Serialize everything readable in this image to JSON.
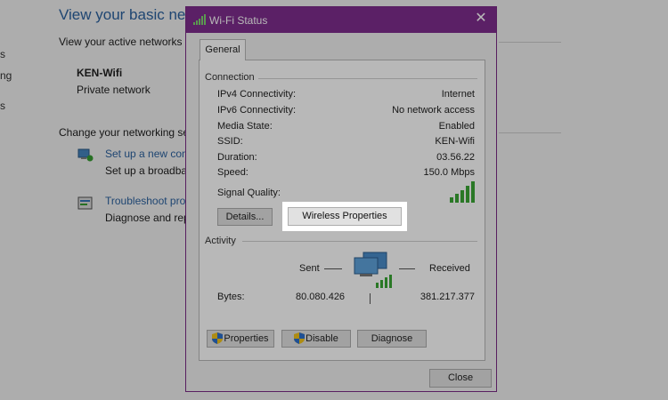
{
  "background": {
    "heading": "View your basic netw",
    "active_networks_label": "View your active networks",
    "network_name": "KEN-Wifi",
    "network_type": "Private network",
    "change_settings_label": "Change your networking se",
    "setup_link": "Set up a new conr",
    "setup_desc": "Set up a broadbar",
    "troubleshoot_link": "Troubleshoot prob",
    "troubleshoot_desc": "Diagnose and rep",
    "side_fragments": [
      "s",
      "ng",
      "s"
    ]
  },
  "dialog": {
    "title": "Wi-Fi Status",
    "close_glyph": "✕",
    "tab": "General",
    "connection": {
      "label": "Connection",
      "rows": [
        {
          "label": "IPv4 Connectivity:",
          "value": "Internet"
        },
        {
          "label": "IPv6 Connectivity:",
          "value": "No network access"
        },
        {
          "label": "Media State:",
          "value": "Enabled"
        },
        {
          "label": "SSID:",
          "value": "KEN-Wifi"
        },
        {
          "label": "Duration:",
          "value": "03.56.22"
        },
        {
          "label": "Speed:",
          "value": "150.0 Mbps"
        }
      ],
      "signal_label": "Signal Quality:",
      "signal_bars": 5
    },
    "details_button": "Details...",
    "wireless_properties_button": "Wireless Properties",
    "activity": {
      "label": "Activity",
      "sent_label": "Sent",
      "received_label": "Received",
      "bytes_label": "Bytes:",
      "sent_bytes": "80.080.426",
      "received_bytes": "381.217.377"
    },
    "properties_button": "Properties",
    "disable_button": "Disable",
    "diagnose_button": "Diagnose",
    "close_button": "Close"
  },
  "colors": {
    "titlebar": "#7e2c8d",
    "link": "#2e67a8",
    "signal": "#3aa635"
  },
  "icons": [
    "wifi-signal-icon",
    "close-icon",
    "shield-icon",
    "network-computer-icon",
    "setup-connection-icon",
    "troubleshoot-icon"
  ]
}
